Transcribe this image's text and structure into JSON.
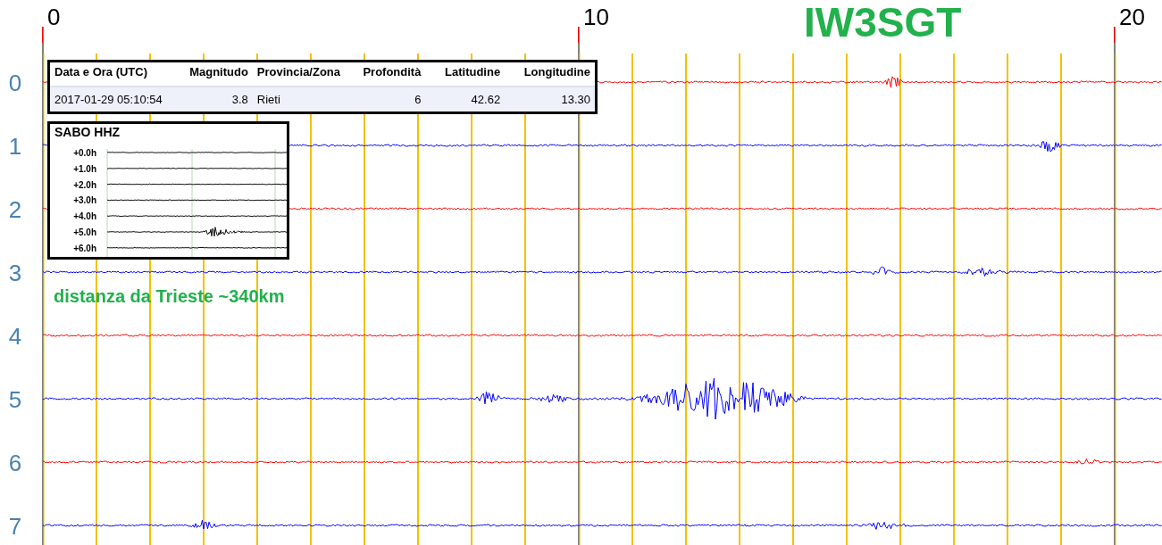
{
  "plot": {
    "x_labels": [
      "0",
      "10",
      "20"
    ],
    "station": "IW3SGT",
    "rows": [
      {
        "label": "0",
        "color": "#ff0000"
      },
      {
        "label": "1",
        "color": "#0000ff"
      },
      {
        "label": "2",
        "color": "#ff0000"
      },
      {
        "label": "3",
        "color": "#0000ff"
      },
      {
        "label": "4",
        "color": "#ff0000"
      },
      {
        "label": "5",
        "color": "#0000ff"
      },
      {
        "label": "6",
        "color": "#ff0000"
      },
      {
        "label": "7",
        "color": "#0000ff"
      }
    ]
  },
  "event_table": {
    "columns": [
      "Data e Ora (UTC)",
      "Magnitudo",
      "Provincia/Zona",
      "Profondità",
      "Latitudine",
      "Longitudine"
    ],
    "rows": [
      [
        "2017-01-29 05:10:54",
        "3.8",
        "Rieti",
        "6",
        "42.62",
        "13.30"
      ]
    ]
  },
  "inset": {
    "title": "SABO HHZ",
    "row_labels": [
      "+0.0h",
      "+1.0h",
      "+2.0h",
      "+3.0h",
      "+4.0h",
      "+5.0h",
      "+6.0h"
    ]
  },
  "distance_note": "distanza da Trieste ~340km"
}
